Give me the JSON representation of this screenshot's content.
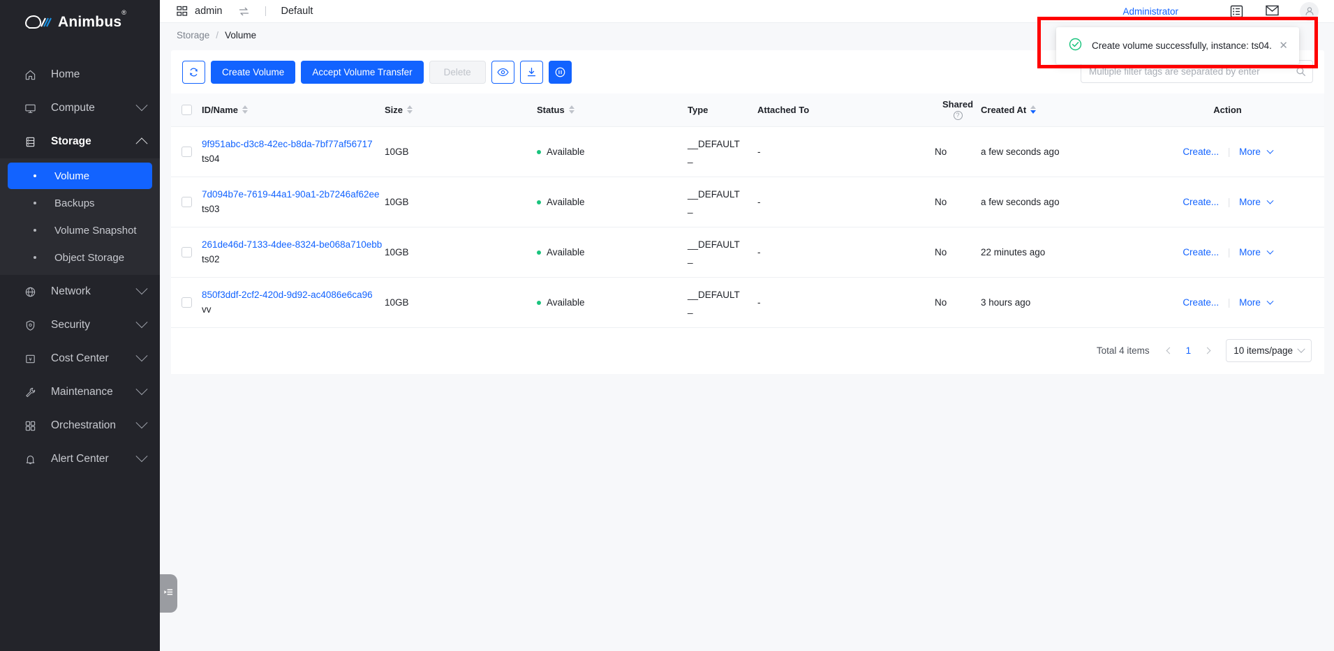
{
  "brand": {
    "name": "Animbus",
    "registered": "®"
  },
  "topbar": {
    "project_icon": "grid-icon",
    "project": "admin",
    "swap_icon": "swap-icon",
    "region": "Default",
    "admin_link": "Administrator",
    "list_icon": "list-panel-icon",
    "mail_icon": "mail-icon",
    "avatar_icon": "user-avatar-icon"
  },
  "breadcrumb": {
    "parent": "Storage",
    "separator": "/",
    "current": "Volume"
  },
  "sidebar": {
    "items": [
      {
        "label": "Home",
        "icon": "home-icon",
        "expandable": false
      },
      {
        "label": "Compute",
        "icon": "monitor-icon",
        "expandable": true,
        "expanded": false
      },
      {
        "label": "Storage",
        "icon": "storage-icon",
        "expandable": true,
        "expanded": true
      },
      {
        "label": "Network",
        "icon": "globe-icon",
        "expandable": true,
        "expanded": false
      },
      {
        "label": "Security",
        "icon": "shield-icon",
        "expandable": true,
        "expanded": false
      },
      {
        "label": "Cost Center",
        "icon": "billing-icon",
        "expandable": true,
        "expanded": false
      },
      {
        "label": "Maintenance",
        "icon": "wrench-icon",
        "expandable": true,
        "expanded": false
      },
      {
        "label": "Orchestration",
        "icon": "blocks-icon",
        "expandable": true,
        "expanded": false
      },
      {
        "label": "Alert Center",
        "icon": "bell-icon",
        "expandable": true,
        "expanded": false
      }
    ],
    "storage_submenu": [
      {
        "label": "Volume",
        "active": true
      },
      {
        "label": "Backups",
        "active": false
      },
      {
        "label": "Volume Snapshot",
        "active": false
      },
      {
        "label": "Object Storage",
        "active": false
      }
    ]
  },
  "toolbar": {
    "refresh_icon": "refresh-icon",
    "create_volume": "Create Volume",
    "accept_transfer": "Accept Volume Transfer",
    "delete": "Delete",
    "view_icon": "eye-icon",
    "download_icon": "download-icon",
    "pause_icon": "pause-circle-icon"
  },
  "filter": {
    "placeholder": "Multiple filter tags are separated by enter",
    "value": "",
    "search_icon": "search-icon"
  },
  "table": {
    "columns": [
      {
        "key": "checkbox",
        "label": ""
      },
      {
        "key": "id_name",
        "label": "ID/Name",
        "sortable": true
      },
      {
        "key": "size",
        "label": "Size",
        "sortable": true
      },
      {
        "key": "status",
        "label": "Status",
        "sortable": true
      },
      {
        "key": "type",
        "label": "Type",
        "sortable": false
      },
      {
        "key": "attached_to",
        "label": "Attached To",
        "sortable": false
      },
      {
        "key": "shared",
        "label": "Shared",
        "sortable": false,
        "help": "?"
      },
      {
        "key": "created_at",
        "label": "Created At",
        "sortable": true,
        "sorted": "desc"
      },
      {
        "key": "action",
        "label": "Action",
        "sortable": false
      }
    ],
    "rows": [
      {
        "id": "9f951abc-d3c8-42ec-b8da-7bf77af56717",
        "name": "ts04",
        "size": "10GB",
        "status": "Available",
        "type_line1": "__DEFAULT",
        "type_line2": "_",
        "attached_to": "-",
        "shared": "No",
        "created_at": "a few seconds ago",
        "action_primary": "Create...",
        "action_more": "More"
      },
      {
        "id": "7d094b7e-7619-44a1-90a1-2b7246af62ee",
        "name": "ts03",
        "size": "10GB",
        "status": "Available",
        "type_line1": "__DEFAULT",
        "type_line2": "_",
        "attached_to": "-",
        "shared": "No",
        "created_at": "a few seconds ago",
        "action_primary": "Create...",
        "action_more": "More"
      },
      {
        "id": "261de46d-7133-4dee-8324-be068a710ebb",
        "name": "ts02",
        "size": "10GB",
        "status": "Available",
        "type_line1": "__DEFAULT",
        "type_line2": "_",
        "attached_to": "-",
        "shared": "No",
        "created_at": "22 minutes ago",
        "action_primary": "Create...",
        "action_more": "More"
      },
      {
        "id": "850f3ddf-2cf2-420d-9d92-ac4086e6ca96",
        "name": "vv",
        "size": "10GB",
        "status": "Available",
        "type_line1": "__DEFAULT",
        "type_line2": "_",
        "attached_to": "-",
        "shared": "No",
        "created_at": "3 hours ago",
        "action_primary": "Create...",
        "action_more": "More"
      }
    ]
  },
  "pagination": {
    "total": "Total 4 items",
    "current_page": "1",
    "page_size": "10 items/page"
  },
  "toast": {
    "status_icon": "success-check-icon",
    "message": "Create volume successfully, instance: ts04.",
    "close_icon": "close-icon"
  },
  "colors": {
    "accent": "#1263ff",
    "sidebar_bg": "#23242a",
    "submenu_bg": "#2b2c32",
    "status_green": "#19c37d",
    "annotation_red": "#ff0000",
    "page_bg": "#f7f8fa"
  },
  "collapse_handle": {
    "icon": "collapse-sidebar-icon"
  }
}
